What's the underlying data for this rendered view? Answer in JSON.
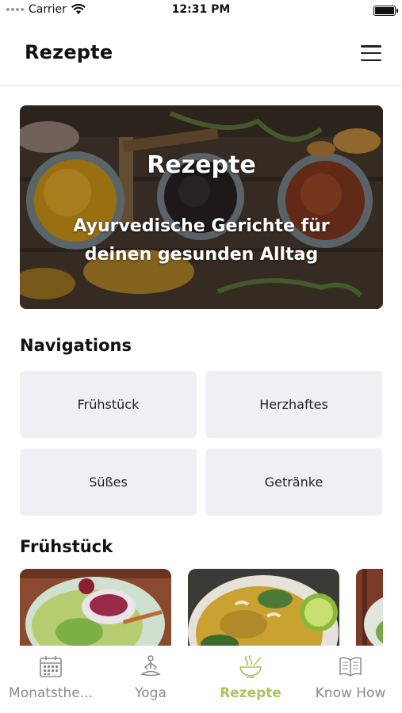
{
  "status_bar": {
    "carrier": "Carrier",
    "time": "12:31 PM"
  },
  "header": {
    "title": "Rezepte"
  },
  "hero": {
    "title": "Rezepte",
    "subtitle": "Ayurvedische Gerichte für deinen gesunden Alltag"
  },
  "navigation": {
    "title": "Navigations",
    "tiles": [
      "Frühstück",
      "Herzhaftes",
      "Süßes",
      "Getränke"
    ]
  },
  "featured": {
    "title": "Frühstück"
  },
  "tab_bar": {
    "accent_color": "#a8c45c",
    "inactive_color": "#8a8a8a",
    "tabs": [
      {
        "label": "Monatsthe...",
        "icon": "calendar-icon",
        "active": false
      },
      {
        "label": "Yoga",
        "icon": "yoga-icon",
        "active": false
      },
      {
        "label": "Rezepte",
        "icon": "bowl-icon",
        "active": true
      },
      {
        "label": "Know How",
        "icon": "book-icon",
        "active": false
      }
    ]
  }
}
